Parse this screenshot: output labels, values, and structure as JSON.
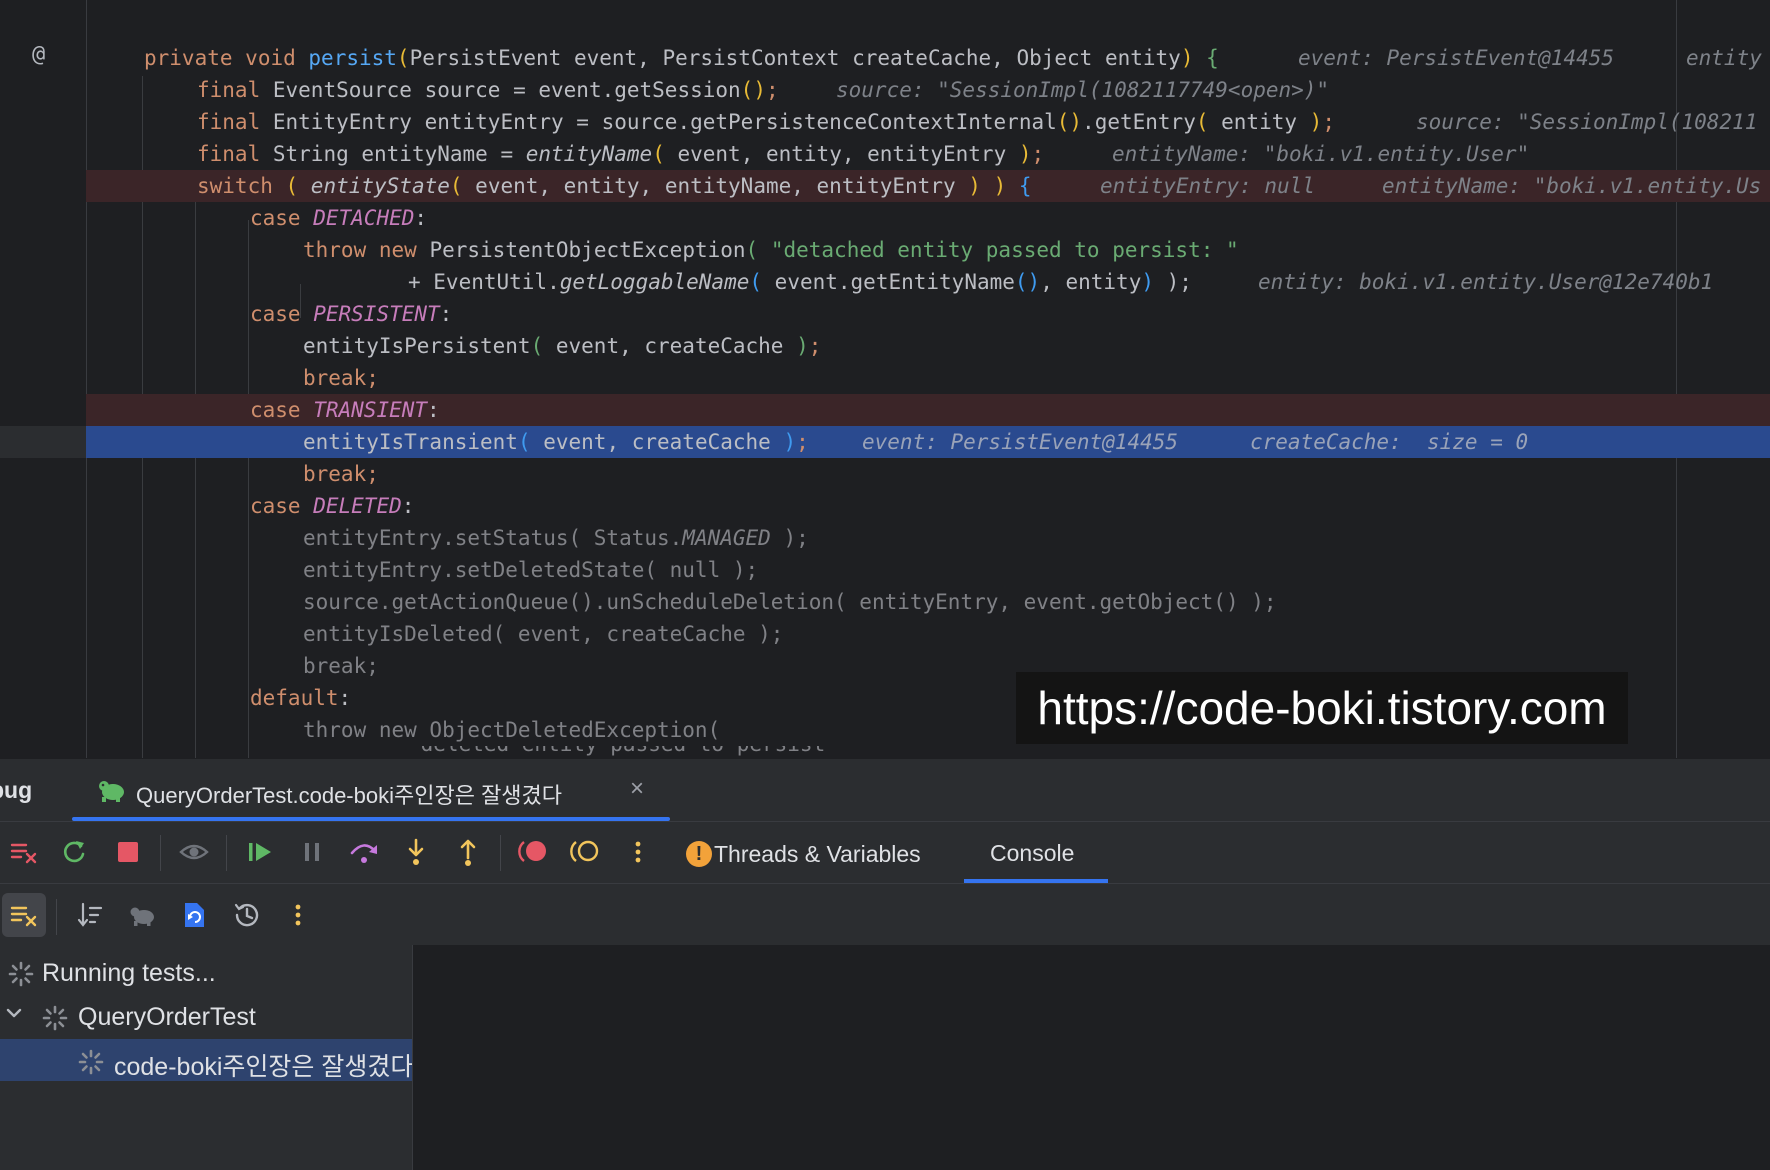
{
  "editor": {
    "gutter_marker": "@",
    "lines": {
      "l1": {
        "private_kw": "private",
        "void_kw": "void",
        "method": "persist",
        "open_paren": "(",
        "params": "PersistEvent event, PersistContext createCache, Object entity",
        "close_paren": ")",
        "brace": "{",
        "hint1": "event: PersistEvent@14455",
        "hint2": "entity"
      },
      "l2": {
        "final_kw": "final",
        "code": "EventSource source = event.getSession",
        "parens": "()",
        "semi": ";",
        "hint": "source: \"SessionImpl(1082117749<open>)\""
      },
      "l3": {
        "final_kw": "final",
        "code_a": "EntityEntry entityEntry = source.getPersistenceContextInternal",
        "parens": "()",
        "code_b": ".getEntry",
        "open_paren": "(",
        "arg": " entity ",
        "close_paren": ")",
        "semi": ";",
        "hint": "source: \"SessionImpl(108211"
      },
      "l4": {
        "final_kw": "final",
        "code": "String entityName = ",
        "fn": "entityName",
        "open_paren": "(",
        "args": " event, entity, entityEntry ",
        "close_paren": ")",
        "semi": ";",
        "hint": "entityName: \"boki.v1.entity.User\""
      },
      "l5": {
        "switch_kw": "switch",
        "open_paren": " ( ",
        "fn": "entityState",
        "open_paren2": "(",
        "args": " event, entity, entityName, entityEntry ",
        "close_paren2": ")",
        "close_paren": " ) ",
        "brace": "{",
        "hint1": "entityEntry: null",
        "hint2": "entityName: \"boki.v1.entity.Us"
      },
      "l6": {
        "case_kw": "case",
        "const": "DETACHED",
        "colon": ":"
      },
      "l7": {
        "throw_kw": "throw",
        "new_kw": "new",
        "cls": "PersistentObjectException",
        "open_paren": "(",
        "str": " \"detached entity passed to persist: \""
      },
      "l8": {
        "plus": "+ EventUtil.",
        "fn": "getLoggableName",
        "open_paren": "(",
        "args_a": " event.getEntityName",
        "parens": "()",
        "args_b": ", entity",
        "close_paren": ")",
        "tail": " );",
        "hint": "entity: boki.v1.entity.User@12e740b1"
      },
      "l9": {
        "case_kw": "case",
        "const": "PERSISTENT",
        "colon": ":"
      },
      "l10": {
        "code": "entityIsPersistent",
        "open_paren": "(",
        "args": " event, createCache ",
        "close_paren": ")",
        "semi": ";"
      },
      "l11": {
        "break_kw": "break",
        "semi": ";"
      },
      "l12": {
        "case_kw": "case",
        "const": "TRANSIENT",
        "colon": ":"
      },
      "l13": {
        "code": "entityIsTransient",
        "open_paren": "(",
        "args": " event, createCache ",
        "close_paren": ")",
        "semi": ";",
        "hint1": "event: PersistEvent@14455",
        "hint2": "createCache:  size = 0"
      },
      "l14": {
        "break_kw": "break",
        "semi": ";"
      },
      "l15": {
        "case_kw": "case",
        "const": "DELETED",
        "colon": ":"
      },
      "l16": {
        "code_a": "entityEntry.setStatus( Status.",
        "const": "MANAGED",
        "code_b": " );"
      },
      "l17": {
        "code": "entityEntry.setDeletedState( null );"
      },
      "l18": {
        "code": "source.getActionQueue().unScheduleDeletion( entityEntry, event.getObject() );"
      },
      "l19": {
        "code": "entityIsDeleted( event, createCache );"
      },
      "l20": {
        "code": "break;"
      },
      "l21": {
        "default_kw": "default",
        "colon": ":"
      },
      "l22": {
        "code": "throw new ObjectDeletedException("
      },
      "l23": {
        "code": "\"deleted entity passed to persist\""
      }
    },
    "watermark": "https://code-boki.tistory.com"
  },
  "debug": {
    "tool_window_name": "bug",
    "session_tab": "QueryOrderTest.code-boki주인장은 잘생겼다",
    "session_close": "×",
    "tabs": {
      "threads_variables": "Threads & Variables",
      "console": "Console"
    },
    "tree": {
      "status": "Running tests...",
      "class_node": "QueryOrderTest",
      "test_node": "code-boki주인장은 잘생겼다"
    },
    "colors": {
      "accent": "#3574f0",
      "stop_red": "#e55765",
      "resume_green": "#5fb865",
      "step_orange": "#f2c55c",
      "warning_orange": "#f2a23a"
    }
  }
}
